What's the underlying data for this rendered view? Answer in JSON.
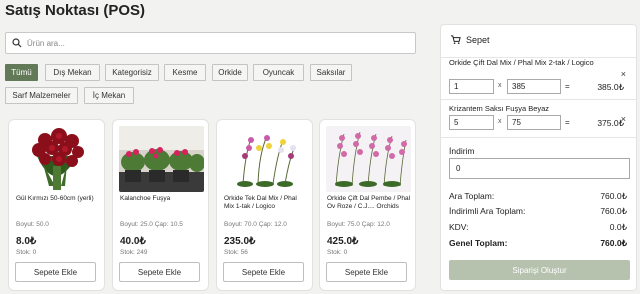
{
  "page": {
    "title": "Satış Noktası (POS)"
  },
  "search": {
    "placeholder": "Ürün ara...",
    "value": ""
  },
  "filters": [
    {
      "label": "Tümü",
      "active": true
    },
    {
      "label": "Dış Mekan"
    },
    {
      "label": "Kategorisiz"
    },
    {
      "label": "Kesme"
    },
    {
      "label": "Orkide"
    },
    {
      "label": "Oyuncak"
    },
    {
      "label": "Saksılar"
    },
    {
      "label": "Sarf Malzemeler"
    },
    {
      "label": "İç Mekan"
    }
  ],
  "products": [
    {
      "name": "Gül Kırmızı 50-60cm (yerli)",
      "meta": "Boyut: 50.0",
      "price": "8.0₺",
      "stock": "Stok: 0",
      "button": "Sepete Ekle"
    },
    {
      "name": "Kalanchoe Fuşya",
      "meta": "Boyut: 25.0 Çap: 10.5",
      "price": "40.0₺",
      "stock": "Stok: 249",
      "button": "Sepete Ekle"
    },
    {
      "name": "Orkide Tek Dal Mix / Phal Mix 1-tak / Logico",
      "meta": "Boyut: 70.0 Çap: 12.0",
      "price": "235.0₺",
      "stock": "Stok: 56",
      "button": "Sepete Ekle"
    },
    {
      "name": "Orkide Çift Dal Pembe / Phal Ov Roze / C.J.... Orchids",
      "meta": "Boyut: 75.0 Çap: 12.0",
      "price": "425.0₺",
      "stock": "Stok: 0",
      "button": "Sepete Ekle"
    }
  ],
  "cart": {
    "title": "Sepet",
    "items": [
      {
        "name": "Orkide Çift Dal Mix / Phal Mix 2-tak / Logico",
        "qty": "1",
        "unit": "385",
        "mul": "x",
        "eq": "=",
        "total": "385.0₺",
        "remove": "×"
      },
      {
        "name": "Krizantem Saksı Fuşya Beyaz",
        "qty": "5",
        "unit": "75",
        "mul": "x",
        "eq": "=",
        "total": "375.0₺",
        "remove": "×"
      }
    ],
    "discount_label": "İndirim",
    "discount_value": "0",
    "subtotal_label": "Ara Toplam:",
    "subtotal": "760.0₺",
    "discounted_label": "İndirimli Ara Toplam:",
    "discounted": "760.0₺",
    "vat_label": "KDV:",
    "vat": "0.0₺",
    "grand_label": "Genel Toplam:",
    "grand": "760.0₺",
    "order_button": "Siparişi Oluştur"
  },
  "colors": {
    "accent": "#637a59",
    "order_button": "#b6c2ae"
  }
}
